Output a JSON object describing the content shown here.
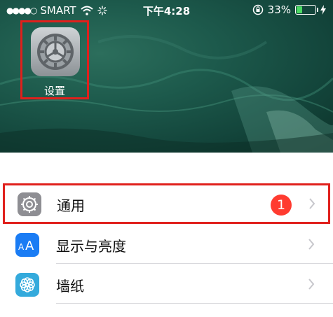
{
  "status_bar": {
    "signal": "●●●●○",
    "carrier": "SMART",
    "time": "下午4:28",
    "battery_percent": "33%",
    "battery_level": 0.33
  },
  "home_screen": {
    "app_label": "设置"
  },
  "settings_list": {
    "items": [
      {
        "label": "通用",
        "icon": "gear-icon",
        "badge": "1",
        "icon_color": "#8e8e93"
      },
      {
        "label": "显示与亮度",
        "icon": "text-size-icon",
        "icon_color": "#1a7cf4"
      },
      {
        "label": "墙纸",
        "icon": "flower-icon",
        "icon_color": "#34aadc"
      }
    ]
  },
  "colors": {
    "highlight_border": "#e0201c",
    "badge": "#ff3b30",
    "battery_fill": "#4cd964"
  }
}
